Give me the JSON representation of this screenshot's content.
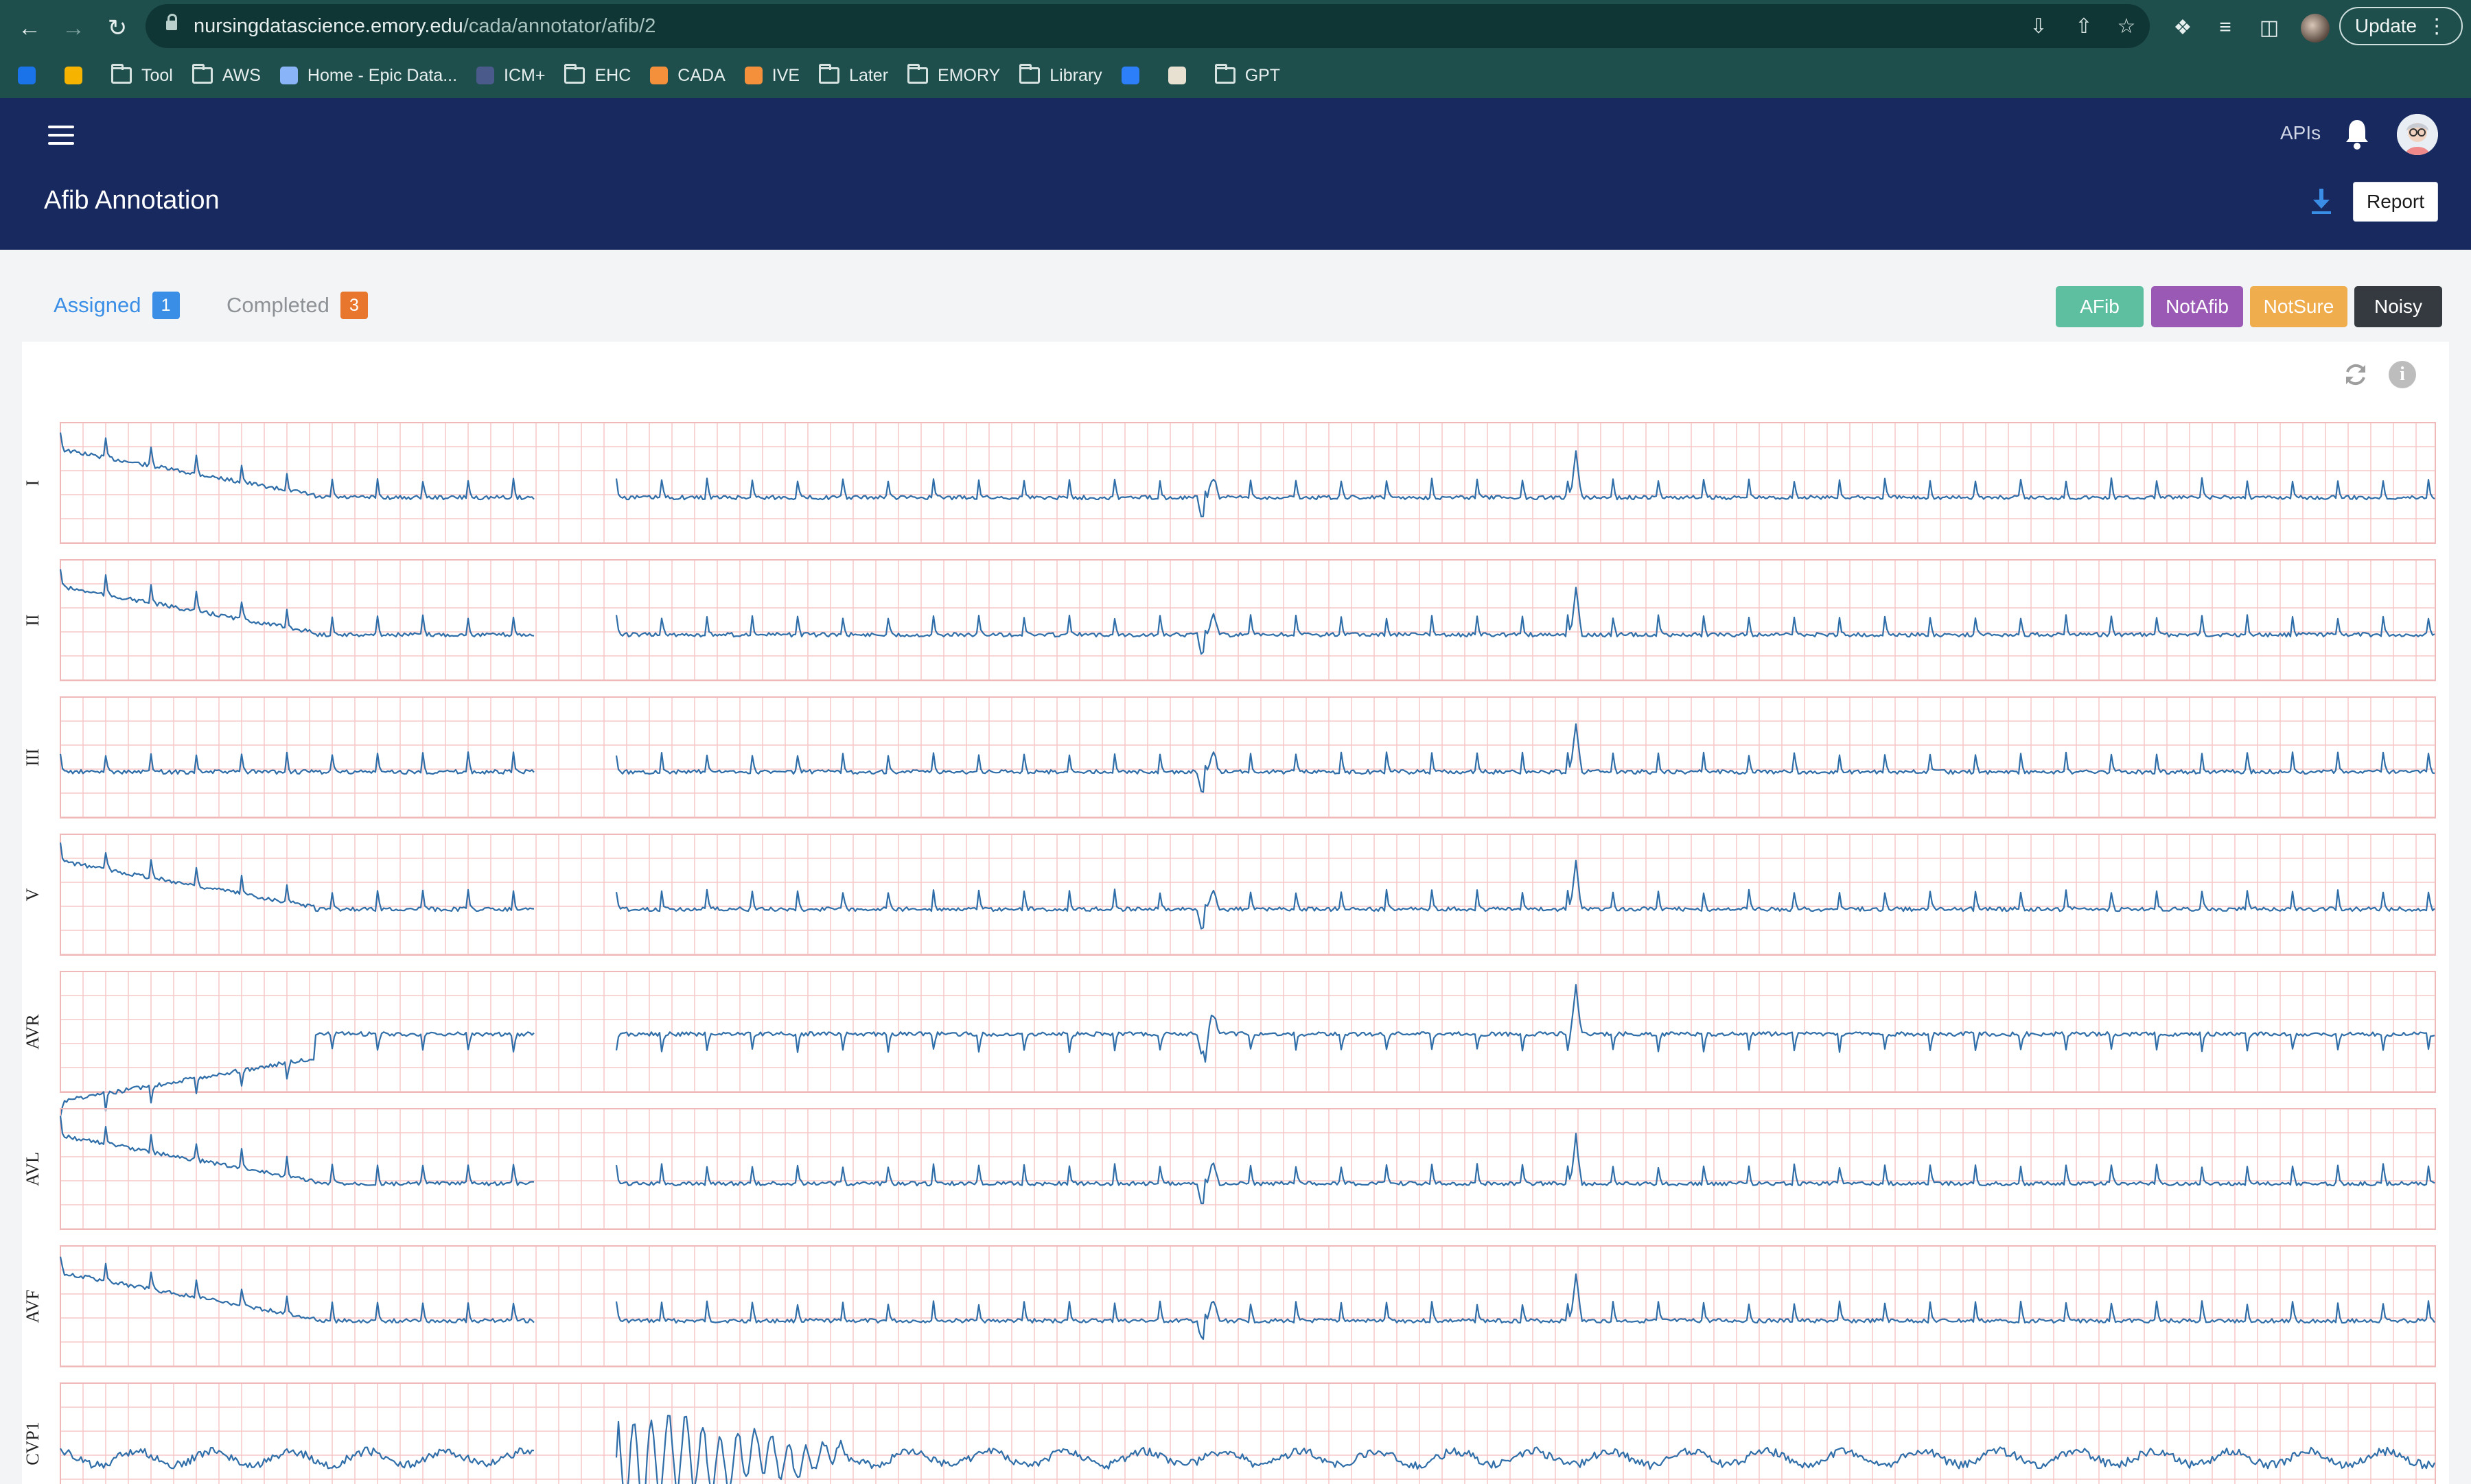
{
  "browser": {
    "url_host": "nursingdatascience.emory.edu",
    "url_path": "/cada/annotator/afib/2",
    "update_label": "Update",
    "bookmarks": [
      {
        "label": "",
        "icon": "outlook-icon"
      },
      {
        "label": "",
        "icon": "keep-icon"
      },
      {
        "label": "Tool",
        "icon": "folder-icon"
      },
      {
        "label": "AWS",
        "icon": "folder-icon"
      },
      {
        "label": "Home - Epic Data...",
        "icon": "epic-icon"
      },
      {
        "label": "ICM+",
        "icon": "cloud-icon"
      },
      {
        "label": "EHC",
        "icon": "folder-icon"
      },
      {
        "label": "CADA",
        "icon": "colab-icon"
      },
      {
        "label": "IVE",
        "icon": "colab-icon"
      },
      {
        "label": "Later",
        "icon": "folder-icon"
      },
      {
        "label": "EMORY",
        "icon": "folder-icon"
      },
      {
        "label": "Library",
        "icon": "folder-icon"
      },
      {
        "label": "",
        "icon": "jira-icon"
      },
      {
        "label": "",
        "icon": "book-icon"
      },
      {
        "label": "GPT",
        "icon": "folder-icon"
      }
    ]
  },
  "header": {
    "title": "Afib Annotation",
    "apis_label": "APIs",
    "report_label": "Report"
  },
  "tabs": {
    "assigned": {
      "label": "Assigned",
      "count": "1"
    },
    "completed": {
      "label": "Completed",
      "count": "3"
    }
  },
  "label_buttons": [
    {
      "label": "AFib",
      "color": "#5dbf9f"
    },
    {
      "label": "NotAfib",
      "color": "#9b59b6"
    },
    {
      "label": "NotSure",
      "color": "#f0ad4e"
    },
    {
      "label": "Noisy",
      "color": "#343a40"
    }
  ],
  "colors": {
    "header_bg": "#17295e",
    "tab_active": "#3a8ee6",
    "badge_blue": "#3a8ee6",
    "badge_orange": "#e8762d",
    "waveform": "#2f6ea8",
    "grid": "#f6c8c8"
  },
  "leads": [
    "I",
    "II",
    "III",
    "V",
    "AVR",
    "AVL",
    "AVF",
    "CVP1"
  ]
}
